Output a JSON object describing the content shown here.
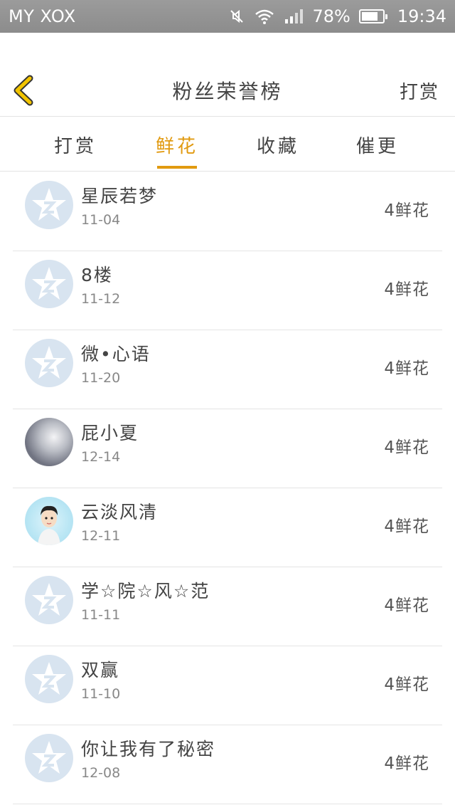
{
  "status_bar": {
    "carrier": "MY XOX",
    "battery": "78%",
    "battery_level": 0.78,
    "time": "19:34",
    "icons": [
      "mute-icon",
      "wifi-icon",
      "signal-icon",
      "battery-icon"
    ]
  },
  "header": {
    "title": "粉丝荣誉榜",
    "right_action": "打赏"
  },
  "tabs": [
    {
      "label": "打赏",
      "active": false
    },
    {
      "label": "鲜花",
      "active": true
    },
    {
      "label": "收藏",
      "active": false
    },
    {
      "label": "催更",
      "active": false
    }
  ],
  "list": [
    {
      "name": "星辰若梦",
      "date": "11-04",
      "count": "4鲜花",
      "avatar": "default-avatar"
    },
    {
      "name": "8楼",
      "date": "11-12",
      "count": "4鲜花",
      "avatar": "default-avatar"
    },
    {
      "name": "微•心语",
      "date": "11-20",
      "count": "4鲜花",
      "avatar": "default-avatar"
    },
    {
      "name": "屁小夏",
      "date": "12-14",
      "count": "4鲜花",
      "avatar": "photo-avatar"
    },
    {
      "name": "云淡风清",
      "date": "12-11",
      "count": "4鲜花",
      "avatar": "cartoon-avatar"
    },
    {
      "name": "学☆院☆风☆范",
      "date": "11-11",
      "count": "4鲜花",
      "avatar": "default-avatar"
    },
    {
      "name": "双赢",
      "date": "11-10",
      "count": "4鲜花",
      "avatar": "default-avatar"
    },
    {
      "name": "你让我有了秘密",
      "date": "12-08",
      "count": "4鲜花",
      "avatar": "default-avatar"
    }
  ],
  "colors": {
    "accent": "#e19a10",
    "back_arrow": "#f2c400",
    "status_bar": "#929292"
  }
}
